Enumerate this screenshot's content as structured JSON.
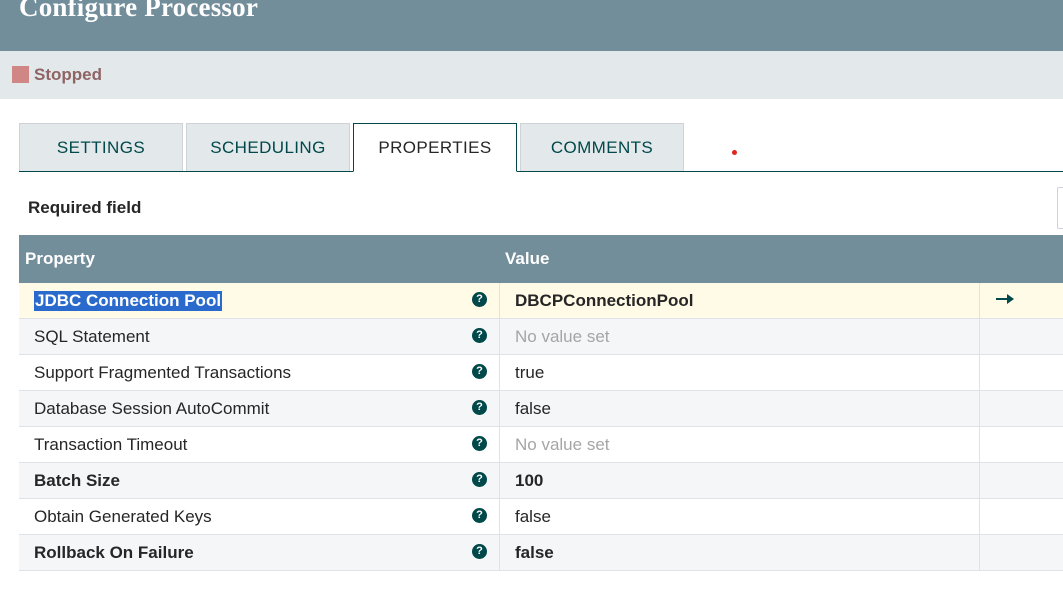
{
  "header": {
    "title": "Configure Processor"
  },
  "status": {
    "text": "Stopped",
    "color": "#d18686"
  },
  "tabs": [
    {
      "label": "SETTINGS",
      "active": false
    },
    {
      "label": "SCHEDULING",
      "active": false
    },
    {
      "label": "PROPERTIES",
      "active": true
    },
    {
      "label": "COMMENTS",
      "active": false
    }
  ],
  "required_field_label": "Required field",
  "table": {
    "columns": {
      "property": "Property",
      "value": "Value"
    },
    "rows": [
      {
        "name": "JDBC Connection Pool",
        "value": "DBCPConnectionPool",
        "required": true,
        "unset": false,
        "selected": true,
        "has_goto": true
      },
      {
        "name": "SQL Statement",
        "value": "No value set",
        "required": false,
        "unset": true
      },
      {
        "name": "Support Fragmented Transactions",
        "value": "true",
        "required": false,
        "unset": false
      },
      {
        "name": "Database Session AutoCommit",
        "value": "false",
        "required": false,
        "unset": false
      },
      {
        "name": "Transaction Timeout",
        "value": "No value set",
        "required": false,
        "unset": true
      },
      {
        "name": "Batch Size",
        "value": "100",
        "required": true,
        "unset": false
      },
      {
        "name": "Obtain Generated Keys",
        "value": "false",
        "required": false,
        "unset": false
      },
      {
        "name": "Rollback On Failure",
        "value": "false",
        "required": true,
        "unset": false
      }
    ]
  },
  "colors": {
    "header_bg": "#728e9b",
    "accent": "#004849",
    "selection": "#2a6acc"
  },
  "icons": {
    "help": "question-circle-icon",
    "goto": "arrow-right-icon"
  }
}
